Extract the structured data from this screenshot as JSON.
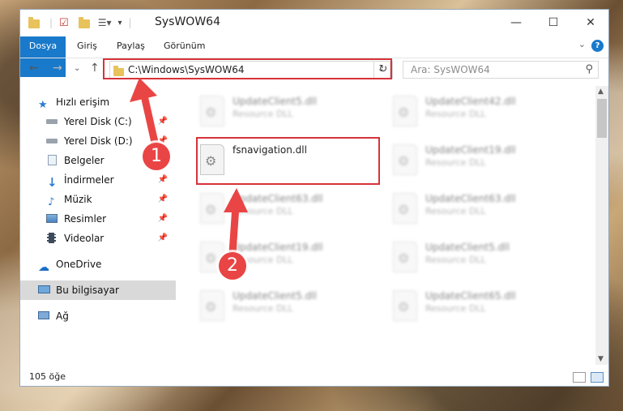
{
  "window": {
    "title": "SysWOW64",
    "minimize": "—",
    "maximize": "☐",
    "close": "✕"
  },
  "ribbon": {
    "tabs": [
      "Dosya",
      "Giriş",
      "Paylaş",
      "Görünüm"
    ],
    "help": "?"
  },
  "address": {
    "path": "C:\\Windows\\SysWOW64",
    "search_placeholder": "Ara: SysWOW64"
  },
  "sidebar": {
    "items": [
      {
        "label": "Hızlı erişim",
        "icon": "star-icon",
        "pinned": false
      },
      {
        "label": "Yerel Disk (C:)",
        "icon": "drive-icon",
        "pinned": true
      },
      {
        "label": "Yerel Disk (D:)",
        "icon": "drive-icon",
        "pinned": true
      },
      {
        "label": "Belgeler",
        "icon": "documents-icon",
        "pinned": true
      },
      {
        "label": "İndirmeler",
        "icon": "download-icon",
        "pinned": true
      },
      {
        "label": "Müzik",
        "icon": "music-icon",
        "pinned": true
      },
      {
        "label": "Resimler",
        "icon": "pictures-icon",
        "pinned": true
      },
      {
        "label": "Videolar",
        "icon": "videos-icon",
        "pinned": true
      },
      {
        "label": "OneDrive",
        "icon": "cloud-icon",
        "pinned": false
      },
      {
        "label": "Bu bilgisayar",
        "icon": "computer-icon",
        "pinned": false,
        "selected": true
      },
      {
        "label": "Ağ",
        "icon": "network-icon",
        "pinned": false
      }
    ]
  },
  "files": {
    "left": [
      {
        "name": "UpdateClient5.dll",
        "type": "Resource DLL"
      },
      {
        "name": "fsnavigation.dll",
        "type": ""
      },
      {
        "name": "UpdateClient63.dll",
        "type": "Resource DLL"
      },
      {
        "name": "UpdateClient19.dll",
        "type": "Resource DLL"
      },
      {
        "name": "UpdateClient5.dll",
        "type": "Resource DLL"
      }
    ],
    "right": [
      {
        "name": "UpdateClient42.dll",
        "type": "Resource DLL"
      },
      {
        "name": "UpdateClient19.dll",
        "type": "Resource DLL"
      },
      {
        "name": "UpdateClient63.dll",
        "type": "Resource DLL"
      },
      {
        "name": "UpdateClient5.dll",
        "type": "Resource DLL"
      },
      {
        "name": "UpdateClient65.dll",
        "type": "Resource DLL"
      }
    ]
  },
  "status": {
    "count": "105 öğe"
  },
  "callouts": [
    "1",
    "2"
  ],
  "colors": {
    "accent": "#1979ca",
    "highlight": "#d7333a",
    "callout": "#e94545"
  }
}
